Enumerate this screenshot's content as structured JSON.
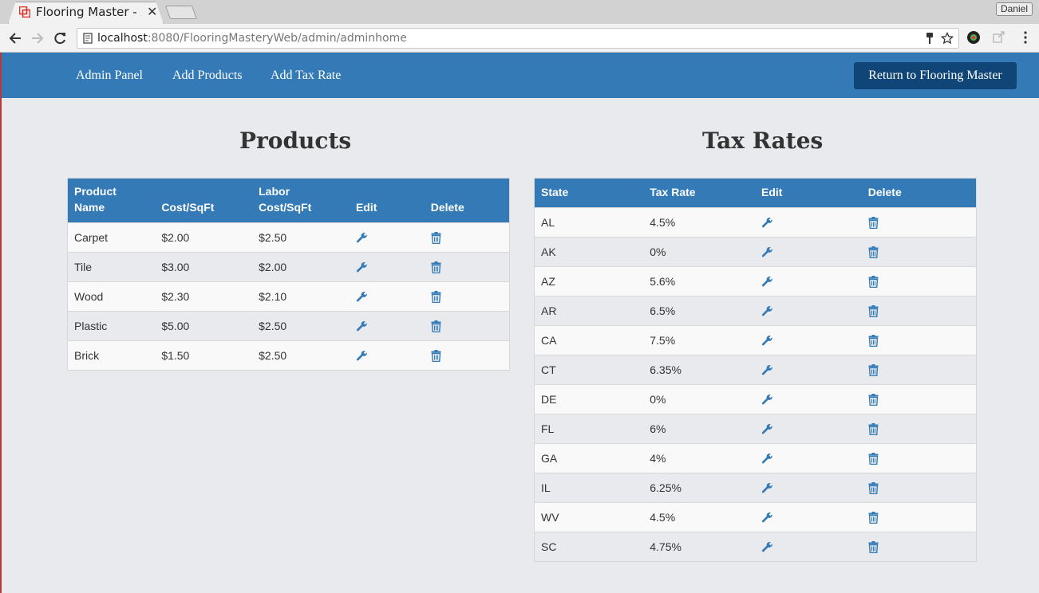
{
  "browser": {
    "tab_title": "Flooring Master - A",
    "tab_title_fade": "d",
    "url_host": "localhost",
    "url_path": ":8080/FlooringMasteryWeb/admin/adminhome",
    "profile_name": "Daniel"
  },
  "navbar": {
    "links": [
      "Admin Panel",
      "Add Products",
      "Add Tax Rate"
    ],
    "return_label": "Return to Flooring Master"
  },
  "products": {
    "title": "Products",
    "headers": {
      "name_1": "Product",
      "name_2": "Name",
      "cost": "Cost/SqFt",
      "labor_1": "Labor",
      "labor_2": "Cost/SqFt",
      "edit": "Edit",
      "delete": "Delete"
    },
    "rows": [
      {
        "name": "Carpet",
        "cost": "$2.00",
        "labor": "$2.50"
      },
      {
        "name": "Tile",
        "cost": "$3.00",
        "labor": "$2.00"
      },
      {
        "name": "Wood",
        "cost": "$2.30",
        "labor": "$2.10"
      },
      {
        "name": "Plastic",
        "cost": "$5.00",
        "labor": "$2.50"
      },
      {
        "name": "Brick",
        "cost": "$1.50",
        "labor": "$2.50"
      }
    ]
  },
  "tax_rates": {
    "title": "Tax Rates",
    "headers": {
      "state": "State",
      "rate": "Tax Rate",
      "edit": "Edit",
      "delete": "Delete"
    },
    "rows": [
      {
        "state": "AL",
        "rate": "4.5%"
      },
      {
        "state": "AK",
        "rate": "0%"
      },
      {
        "state": "AZ",
        "rate": "5.6%"
      },
      {
        "state": "AR",
        "rate": "6.5%"
      },
      {
        "state": "CA",
        "rate": "7.5%"
      },
      {
        "state": "CT",
        "rate": "6.35%"
      },
      {
        "state": "DE",
        "rate": "0%"
      },
      {
        "state": "FL",
        "rate": "6%"
      },
      {
        "state": "GA",
        "rate": "4%"
      },
      {
        "state": "IL",
        "rate": "6.25%"
      },
      {
        "state": "WV",
        "rate": "4.5%"
      },
      {
        "state": "SC",
        "rate": "4.75%"
      }
    ]
  },
  "colors": {
    "brand": "#337ab7",
    "brand_dark": "#0f4677",
    "page_bg": "#e8eaed"
  }
}
